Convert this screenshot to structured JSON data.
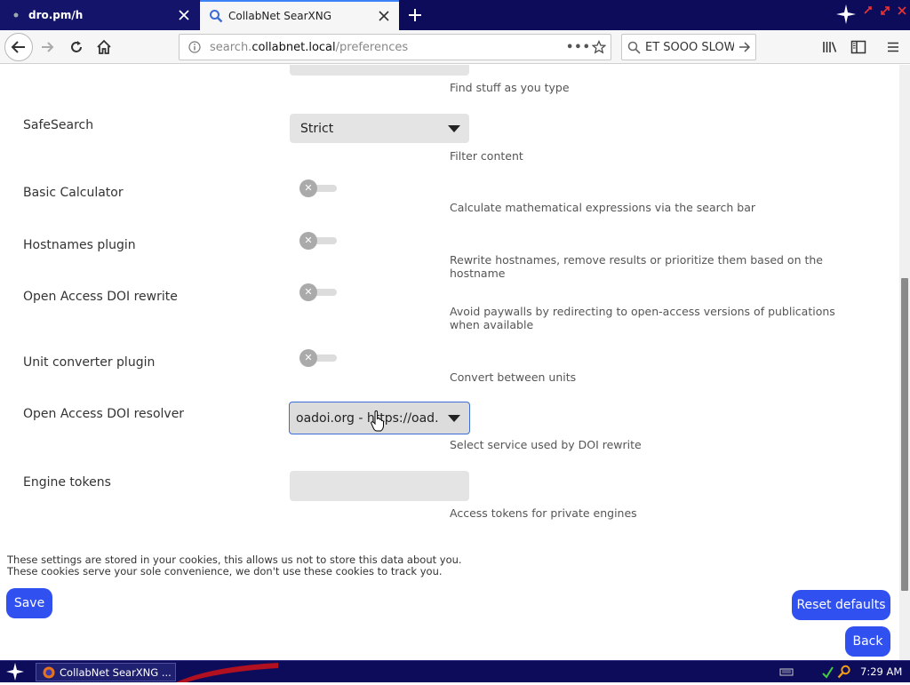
{
  "browser": {
    "tabs": [
      {
        "label": "dro.pm/h",
        "active": false
      },
      {
        "label": "CollabNet SearXNG",
        "active": true
      }
    ],
    "url": {
      "prefix": "search.",
      "host": "collabnet.local",
      "path": "/preferences"
    },
    "search_text": "ET SOOO SLOW",
    "colors": {
      "tabstrip": "#0c0c5a",
      "active_tab_accent": "#3b82f6"
    }
  },
  "page": {
    "partial_row_desc": "Find stuff as you type",
    "rows": {
      "safesearch": {
        "label": "SafeSearch",
        "value": "Strict",
        "desc": "Filter content"
      },
      "calculator": {
        "label": "Basic Calculator",
        "enabled": false,
        "desc": "Calculate mathematical expressions via the search bar"
      },
      "hostnames": {
        "label": "Hostnames plugin",
        "enabled": false,
        "desc": "Rewrite hostnames, remove results or prioritize them based on the hostname"
      },
      "oa_rewrite": {
        "label": "Open Access DOI rewrite",
        "enabled": false,
        "desc": "Avoid paywalls by redirecting to open-access versions of publications when available"
      },
      "unit_converter": {
        "label": "Unit converter plugin",
        "enabled": false,
        "desc": "Convert between units"
      },
      "doi_resolver": {
        "label": "Open Access DOI resolver",
        "value": "oadoi.org - https://oad...",
        "desc": "Select service used by DOI rewrite"
      },
      "engine_tokens": {
        "label": "Engine tokens",
        "value": "",
        "desc": "Access tokens for private engines"
      }
    },
    "cookie_note": {
      "line1": "These settings are stored in your cookies, this allows us not to store this data about you.",
      "line2": "These cookies serve your sole convenience, we don't use these cookies to track you."
    },
    "buttons": {
      "save": "Save",
      "reset": "Reset defaults",
      "back": "Back"
    },
    "colors": {
      "button": "#3050f0",
      "focus_border": "#3d6bd8"
    }
  },
  "taskbar": {
    "task_label": "CollabNet SearXNG ...",
    "clock": "7:29 AM"
  }
}
